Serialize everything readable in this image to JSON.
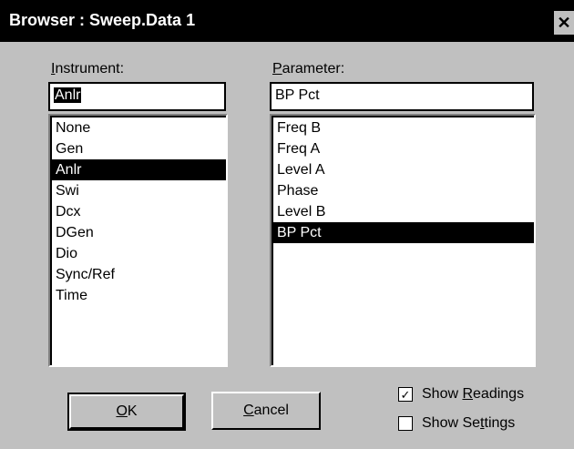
{
  "window": {
    "title": "Browser : Sweep.Data 1",
    "close_glyph": "✕"
  },
  "instrument": {
    "label_u": "I",
    "label_rest": "nstrument:",
    "value": "Anlr",
    "items": [
      "None",
      "Gen",
      "Anlr",
      "Swi",
      "Dcx",
      "DGen",
      "Dio",
      "Sync/Ref",
      "Time"
    ],
    "selected_index": 2
  },
  "parameter": {
    "label_u": "P",
    "label_rest": "arameter:",
    "value": "BP Pct",
    "items": [
      "Freq B",
      "Freq A",
      "Level A",
      "Phase",
      "Level B",
      "BP Pct"
    ],
    "selected_index": 5
  },
  "buttons": {
    "ok_u": "O",
    "ok_rest": "K",
    "cancel_u": "C",
    "cancel_rest": "ancel"
  },
  "options": {
    "show_readings": {
      "pre": "Show ",
      "u": "R",
      "post": "eadings",
      "checked": true,
      "check_glyph": "✓"
    },
    "show_settings": {
      "pre": "Show Se",
      "u": "t",
      "post": "tings",
      "checked": false
    }
  }
}
